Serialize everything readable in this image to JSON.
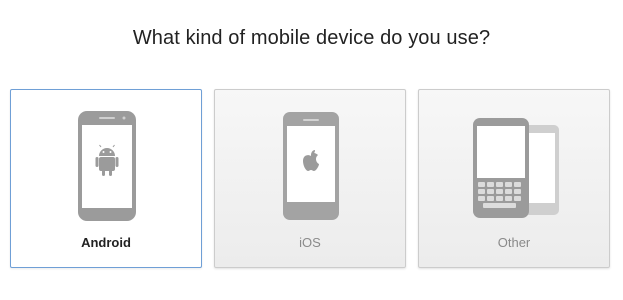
{
  "heading": "What kind of mobile device do you use?",
  "options": [
    {
      "label": "Android",
      "icon": "android-icon",
      "selected": true
    },
    {
      "label": "iOS",
      "icon": "apple-icon",
      "selected": false
    },
    {
      "label": "Other",
      "icon": "blackberry-phone-icon",
      "selected": false
    }
  ],
  "colors": {
    "selected_border": "#6f9fd6",
    "device_gray": "#999999",
    "card_border": "#cccccc"
  }
}
